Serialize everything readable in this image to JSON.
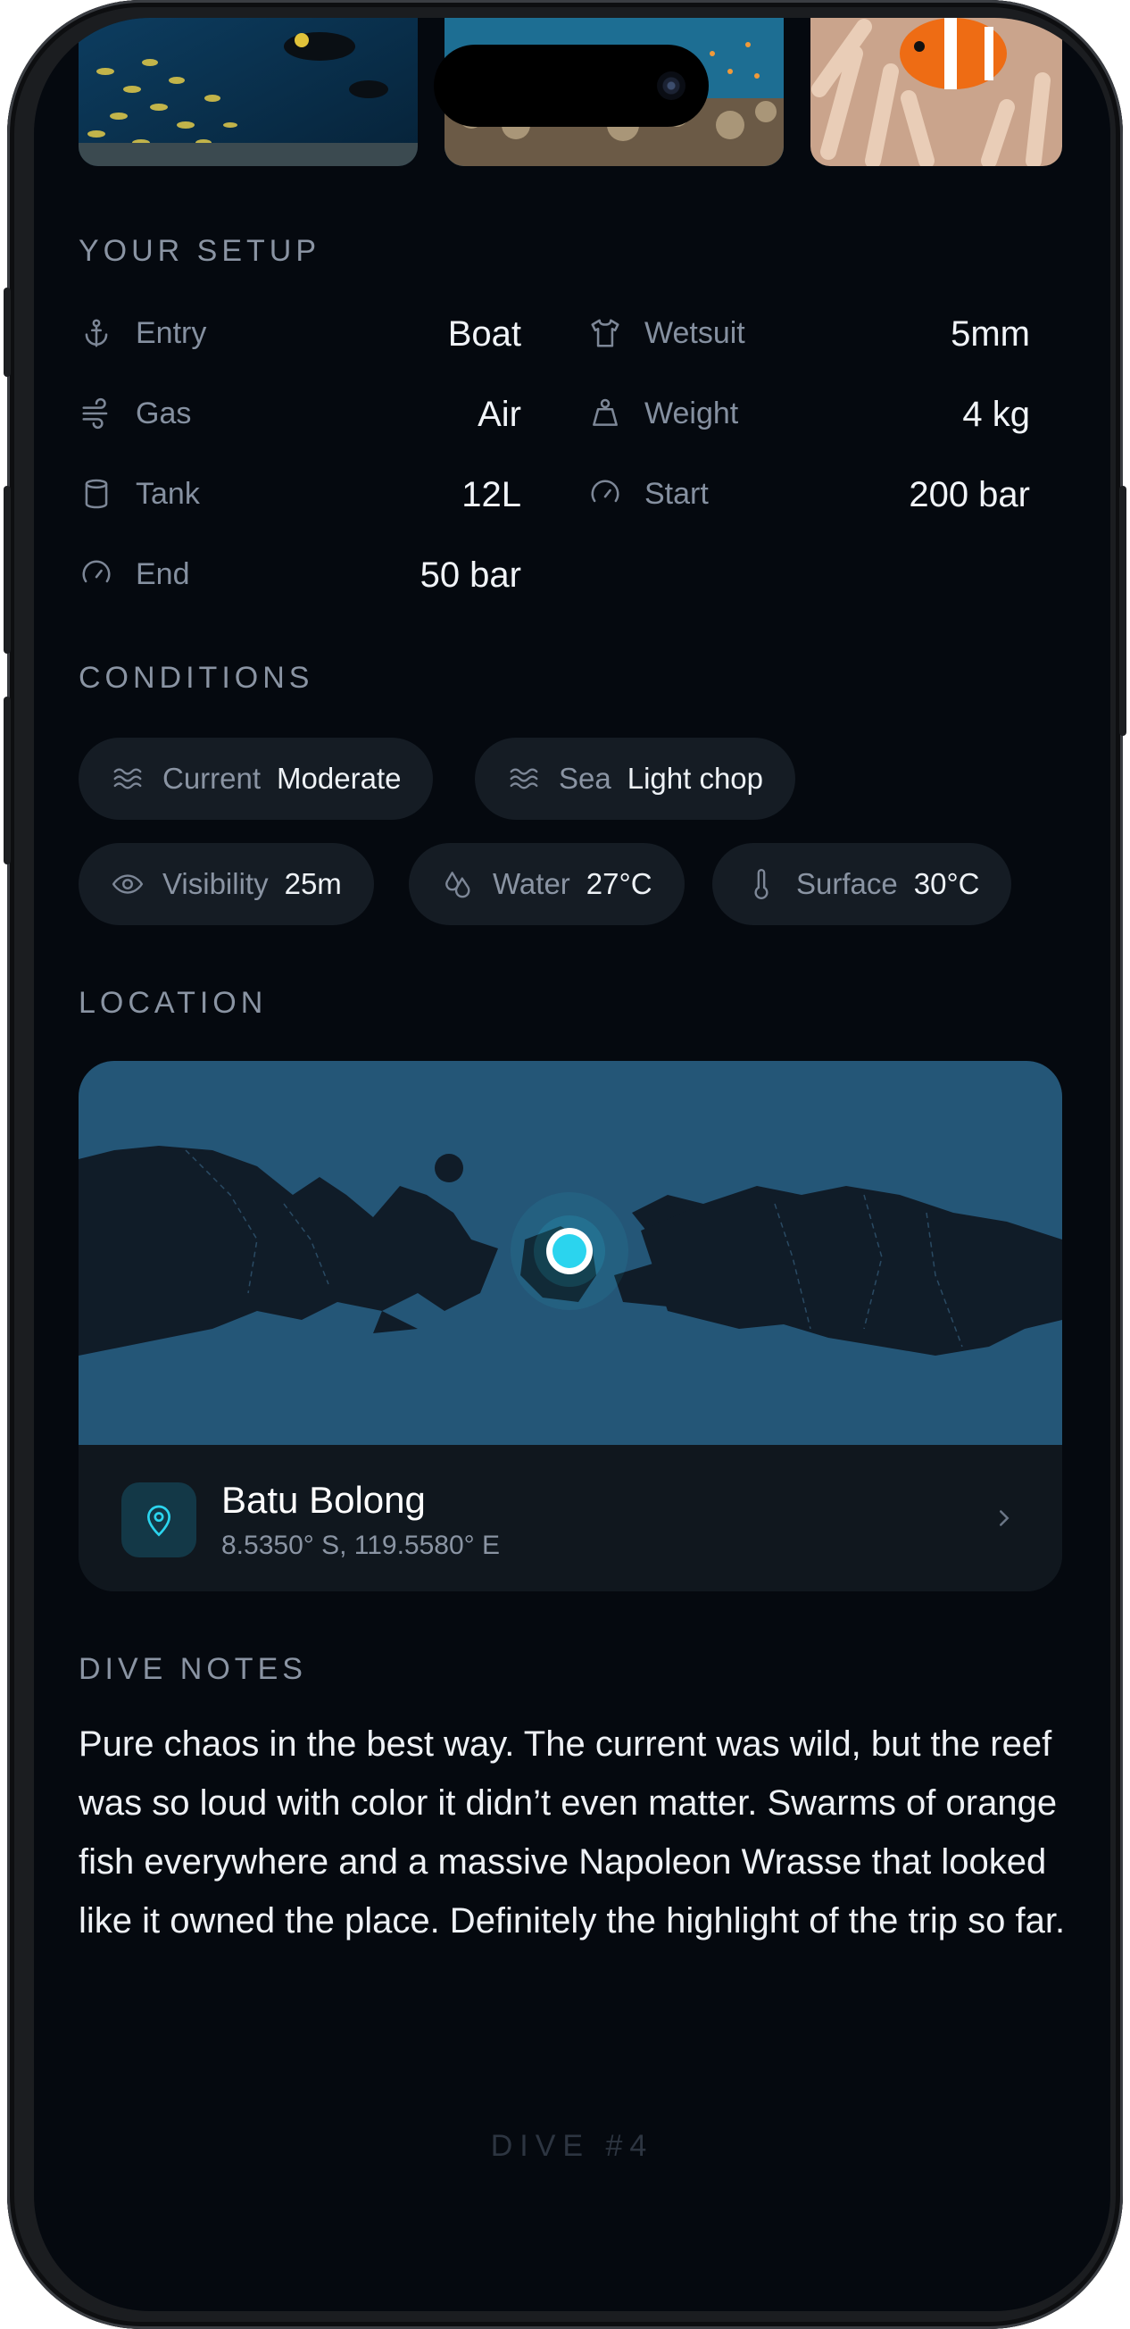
{
  "setup": {
    "title": "YOUR SETUP",
    "left": [
      {
        "icon": "anchor-icon",
        "label": "Entry",
        "value": "Boat"
      },
      {
        "icon": "wind-icon",
        "label": "Gas",
        "value": "Air"
      },
      {
        "icon": "cylinder-icon",
        "label": "Tank",
        "value": "12L"
      },
      {
        "icon": "gauge-icon",
        "label": "End",
        "value": "50 bar"
      }
    ],
    "right": [
      {
        "icon": "shirt-icon",
        "label": "Wetsuit",
        "value": "5mm"
      },
      {
        "icon": "weight-icon",
        "label": "Weight",
        "value": "4 kg"
      },
      {
        "icon": "gauge-icon",
        "label": "Start",
        "value": "200 bar"
      }
    ]
  },
  "conditions": {
    "title": "CONDITIONS",
    "chips": [
      {
        "icon": "waves-icon",
        "label": "Current",
        "value": "Moderate"
      },
      {
        "icon": "waves-icon",
        "label": "Sea",
        "value": "Light chop"
      },
      {
        "icon": "eye-icon",
        "label": "Visibility",
        "value": "25m"
      },
      {
        "icon": "droplets-icon",
        "label": "Water",
        "value": "27°C"
      },
      {
        "icon": "thermometer-icon",
        "label": "Surface",
        "value": "30°C"
      }
    ]
  },
  "location": {
    "title": "LOCATION",
    "name": "Batu Bolong",
    "coords": "8.5350° S, 119.5580° E"
  },
  "notes": {
    "title": "DIVE NOTES",
    "text": "Pure chaos in the best way. The current was wild, but the reef was so loud with color it didn’t even matter. Swarms of orange fish everywhere and a massive Napoleon Wrasse that looked like it owned the place. Definitely the highlight of the trip so far."
  },
  "footer": "DIVE #4",
  "colors": {
    "background": "#05090f",
    "chip": "#151c24",
    "map_water": "#245677",
    "map_land": "#101c28",
    "accent": "#2bd4ee"
  }
}
